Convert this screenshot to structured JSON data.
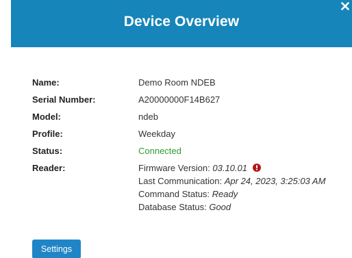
{
  "header": {
    "title": "Device Overview",
    "close_icon": "close-icon"
  },
  "details": {
    "name": {
      "label": "Name:",
      "value": "Demo Room NDEB"
    },
    "serial": {
      "label": "Serial Number:",
      "value": "A20000000F14B627"
    },
    "model": {
      "label": "Model:",
      "value": "ndeb"
    },
    "profile": {
      "label": "Profile:",
      "value": "Weekday"
    },
    "status": {
      "label": "Status:",
      "value": "Connected",
      "color": "#2e9a35"
    },
    "reader": {
      "label": "Reader:",
      "firmware_label": "Firmware Version: ",
      "firmware_value": "03.10.01",
      "warning_icon": "exclamation-circle-icon",
      "last_comm_label": "Last Communication: ",
      "last_comm_value": "Apr 24, 2023, 3:25:03 AM",
      "command_label": "Command Status: ",
      "command_value": "Ready",
      "database_label": "Database Status: ",
      "database_value": "Good"
    }
  },
  "actions": {
    "settings_label": "Settings"
  },
  "colors": {
    "header_bg": "#1685b9",
    "button_bg": "#1f85c6",
    "warning": "#b3161b"
  }
}
